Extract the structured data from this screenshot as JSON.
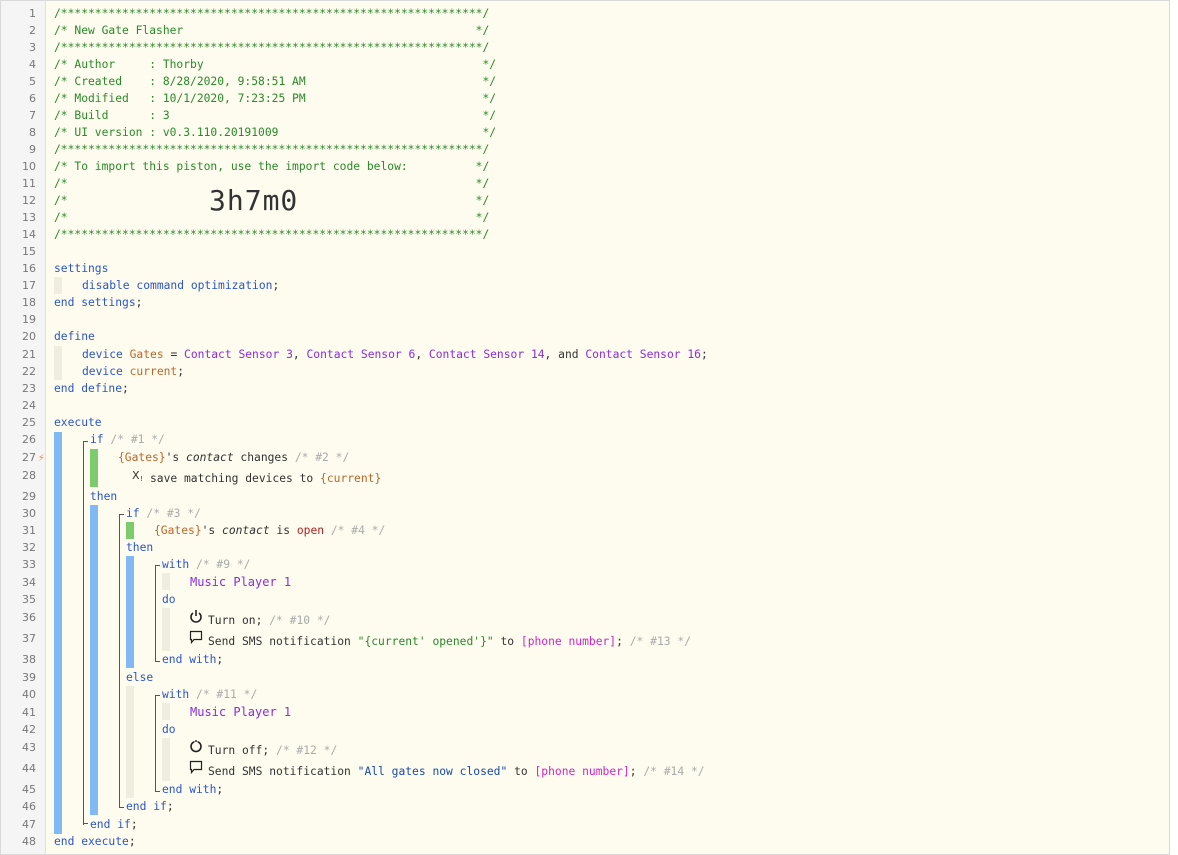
{
  "line_numbers": [
    "1",
    "2",
    "3",
    "4",
    "5",
    "6",
    "7",
    "8",
    "9",
    "10",
    "11",
    "12",
    "13",
    "14",
    "15",
    "16",
    "17",
    "18",
    "19",
    "20",
    "21",
    "22",
    "23",
    "24",
    "25",
    "26",
    "27",
    "28",
    "29",
    "30",
    "31",
    "32",
    "33",
    "34",
    "35",
    "36",
    "37",
    "38",
    "39",
    "40",
    "41",
    "42",
    "43",
    "44",
    "45",
    "46",
    "47",
    "48"
  ],
  "header": {
    "l1": "/**************************************************************/",
    "l2": "/* New Gate Flasher                                           */",
    "l3": "/**************************************************************/",
    "l4": "/* Author     : Thorby                                         */",
    "l5": "/* Created    : 8/28/2020, 9:58:51 AM                          */",
    "l6": "/* Modified   : 10/1/2020, 7:23:25 PM                          */",
    "l7": "/* Build      : 3                                              */",
    "l8": "/* UI version : v0.3.110.20191009                              */",
    "l9": "/**************************************************************/",
    "l10": "/* To import this piston, use the import code below:          */",
    "l11": "/*                                                            */",
    "l12": "/*                                                            */",
    "l13": "/*                                                            */",
    "l14": "/**************************************************************/",
    "import_code": "3h7m0"
  },
  "kw": {
    "settings": "settings",
    "disable_cmd_opt": "disable command optimization",
    "end_settings": "end settings",
    "define": "define",
    "device": "device",
    "end_define": "end define",
    "execute": "execute",
    "if": "if",
    "then": "then",
    "else": "else",
    "with": "with",
    "do": "do",
    "end_with": "end with",
    "end_if": "end if",
    "end_execute": "end execute",
    "semi": ";"
  },
  "define": {
    "gates_var": "Gates",
    "eq": " = ",
    "dev1": "Contact Sensor 3",
    "dev2": "Contact Sensor 6",
    "dev3": "Contact Sensor 14",
    "dev4": "Contact Sensor 16",
    "comma": ", ",
    "and": ", and ",
    "current_var": "current"
  },
  "execute": {
    "c1": "/* #1 */",
    "gates_ref": "{Gates}",
    "poss": "'s ",
    "attr": "contact",
    "changes": " changes ",
    "c2": "/* #2 */",
    "save_text": "save matching devices to ",
    "current_ref": "{current}",
    "c3": "/* #3 */",
    "is": " is ",
    "open": "open",
    "c4": "/* #4 */",
    "c9": "/* #9 */",
    "music_player": "Music Player 1",
    "turn_on": "Turn on;",
    "c10": "/* #10 */",
    "send_sms": "Send SMS notification ",
    "msg_open": "\"{current' opened'}\"",
    "to": " to ",
    "phone": "[phone number]",
    "c13": "/* #13 */",
    "c11": "/* #11 */",
    "turn_off": "Turn off;",
    "c12": "/* #12 */",
    "msg_closed": "\"All gates now closed\"",
    "c14": "/* #14 */"
  },
  "icons": {
    "trigger": "lightning-bolt-icon",
    "save": "save-to-variable-icon",
    "power": "power-icon",
    "message": "message-bubble-icon"
  },
  "colors": {
    "comment": "#2a8a2a",
    "keyword": "#2b55c8",
    "device": "#8a2be2",
    "variable": "#c0652a",
    "dim_comment": "#aaaaaa",
    "placeholder": "#d024c8",
    "open_value": "#b22222",
    "block_blue": "#80b9f4",
    "block_green": "#7ccc6e",
    "background": "#fdfcee"
  }
}
